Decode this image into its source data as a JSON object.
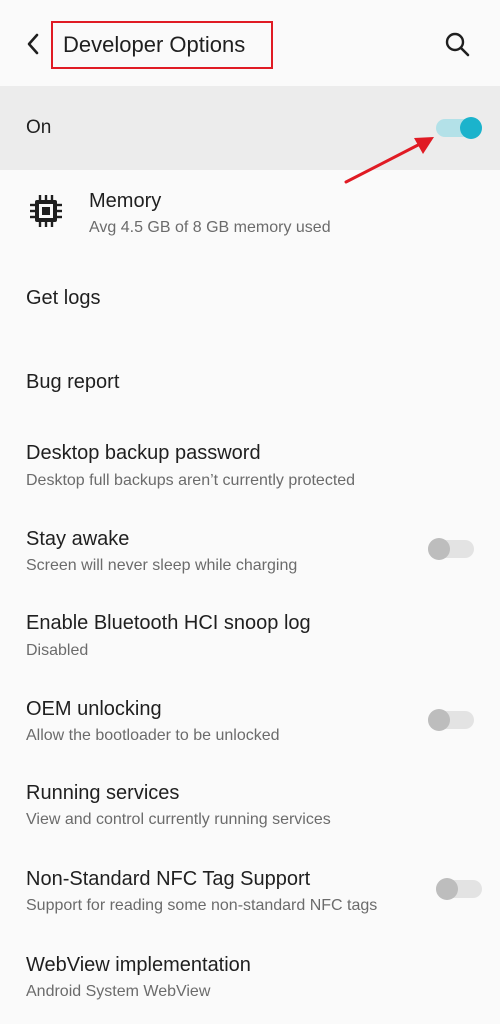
{
  "header": {
    "title": "Developer Options",
    "back_icon": "chevron-left-icon",
    "search_icon": "search-icon"
  },
  "master_switch": {
    "label": "On",
    "checked": true,
    "accent_color": "#1bb3cc"
  },
  "items": [
    {
      "title": "Memory",
      "subtitle": "Avg 4.5 GB of 8 GB memory used",
      "icon": "memory-chip-icon"
    },
    {
      "title": "Get logs"
    },
    {
      "title": "Bug report"
    },
    {
      "title": "Desktop backup password",
      "subtitle": "Desktop full backups aren’t currently protected"
    },
    {
      "title": "Stay awake",
      "subtitle": "Screen will never sleep while charging",
      "toggle": false
    },
    {
      "title": "Enable Bluetooth HCI snoop log",
      "subtitle": "Disabled"
    },
    {
      "title": "OEM unlocking",
      "subtitle": "Allow the bootloader to be unlocked",
      "toggle": false
    },
    {
      "title": "Running services",
      "subtitle": "View and control currently running services"
    },
    {
      "title": "Non-Standard NFC Tag Support",
      "subtitle": "Support for reading some non-standard NFC tags",
      "toggle": false
    },
    {
      "title": "WebView implementation",
      "subtitle": "Android System WebView"
    }
  ],
  "annotation": {
    "highlight_color": "#e01b24"
  }
}
